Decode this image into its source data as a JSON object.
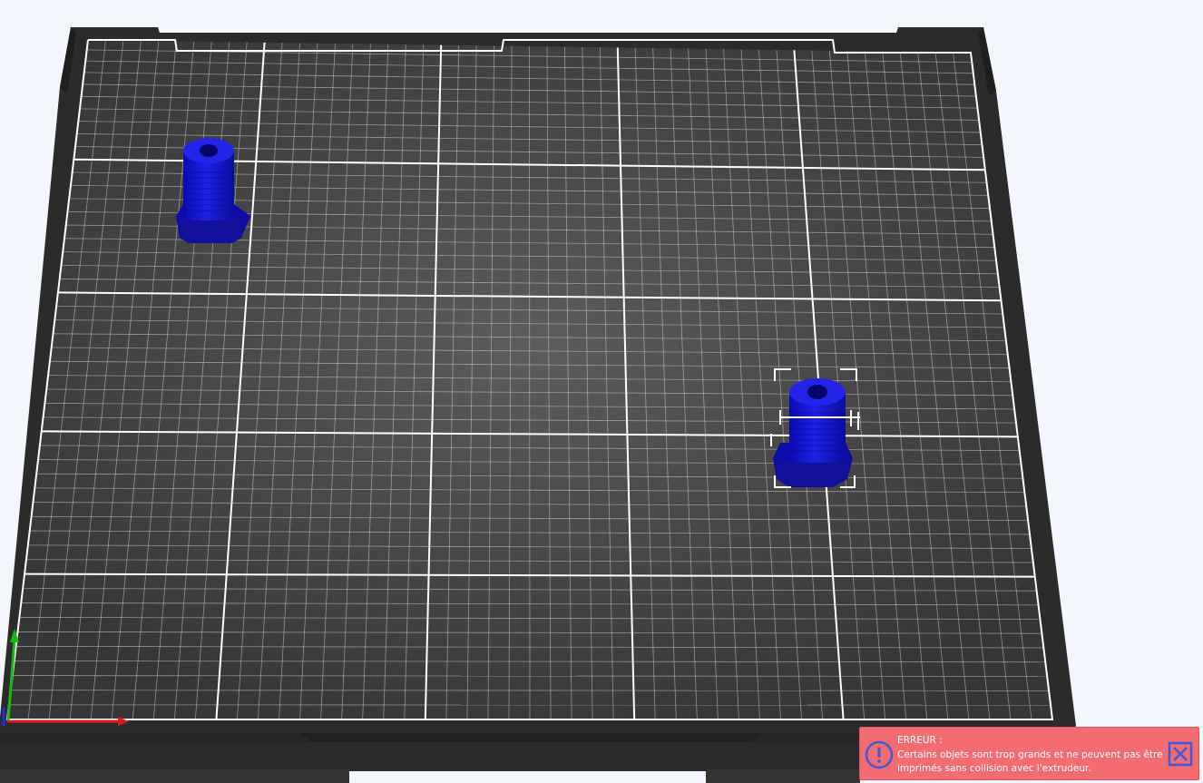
{
  "app": {
    "view": "3d-plater-view"
  },
  "scene": {
    "bed": {
      "surface_color": "#3f3f3f",
      "frame_color": "#2d2d2d",
      "grid_color": "#d9d9d9",
      "grid_major_color": "#ffffff"
    },
    "axes": {
      "x_color": "#e01b1b",
      "y_color": "#18b818",
      "z_color": "#1b2ee0"
    },
    "objects": [
      {
        "name": "object-1",
        "color": "#1414c8",
        "selected": false
      },
      {
        "name": "object-2",
        "color": "#1414c8",
        "selected": true
      }
    ]
  },
  "notification": {
    "level": "error",
    "title": "ERREUR :",
    "message": "Certains objets sont trop grands et ne peuvent pas être imprimés sans collision avec l'extrudeur.",
    "icon": "exclamation-circle-icon",
    "close_icon": "close-box-icon",
    "background": "#f26c72",
    "icon_color": "#3b5bdb"
  }
}
